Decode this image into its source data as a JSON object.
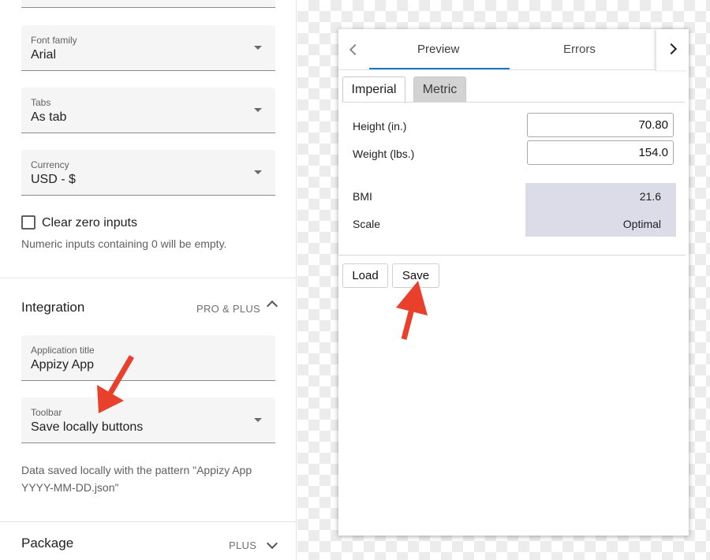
{
  "settings": {
    "font_family": {
      "label": "Font family",
      "value": "Arial"
    },
    "tabs": {
      "label": "Tabs",
      "value": "As tab"
    },
    "currency": {
      "label": "Currency",
      "value": "USD - $"
    },
    "clear_zero": {
      "label": "Clear zero inputs",
      "checked": false,
      "helper": "Numeric inputs containing 0 will be empty."
    },
    "integration": {
      "title": "Integration",
      "badge": "PRO & PLUS",
      "application_title": {
        "label": "Application title",
        "value": "Appizy App"
      },
      "toolbar": {
        "label": "Toolbar",
        "value": "Save locally buttons"
      },
      "helper_line1": "Data saved locally with the pattern \"Appizy App",
      "helper_line2": "YYYY-MM-DD.json\""
    },
    "package": {
      "title": "Package",
      "badge": "PLUS"
    }
  },
  "preview": {
    "tabs": [
      "Preview",
      "Errors"
    ],
    "active_tab": "Preview",
    "accent": "#1976d2",
    "unit_tabs": [
      "Imperial",
      "Metric"
    ],
    "active_unit": "Imperial",
    "height": {
      "label": "Height (in.)",
      "value": "70.80"
    },
    "weight": {
      "label": "Weight (lbs.)",
      "value": "154.0"
    },
    "bmi": {
      "label": "BMI",
      "value": "21.6"
    },
    "scale": {
      "label": "Scale",
      "value": "Optimal"
    },
    "buttons": {
      "load": "Load",
      "save": "Save"
    },
    "output_bg": "#dcdbe8"
  },
  "annotations": {
    "arrow_color": "#e8402a"
  }
}
